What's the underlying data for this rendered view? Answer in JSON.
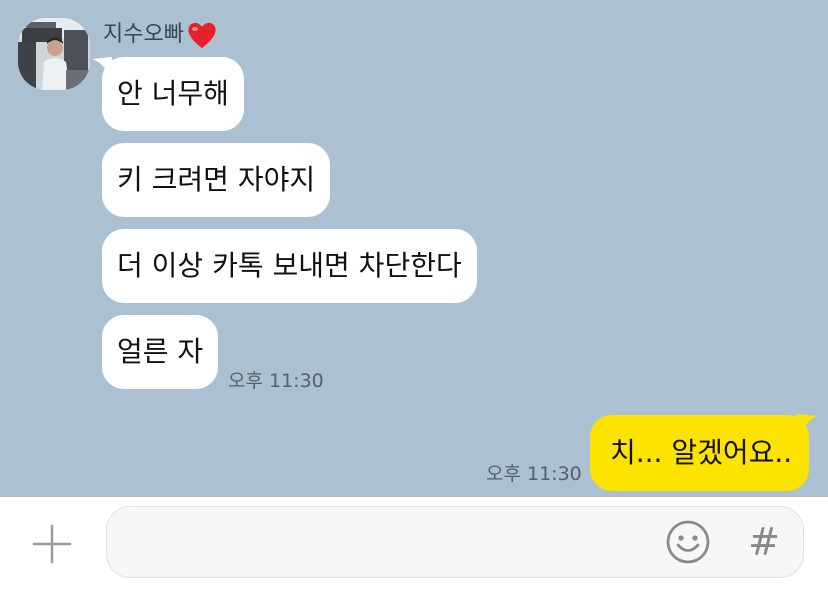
{
  "chat": {
    "sender_name": "지수오빠",
    "sender_badge_icon": "red-heart-icon",
    "incoming_messages": [
      {
        "text": "안 너무해"
      },
      {
        "text": "키 크려면 자야지"
      },
      {
        "text": "더 이상 카톡 보내면 차단한다"
      },
      {
        "text": "얼른 자"
      }
    ],
    "incoming_time": "오후 11:30",
    "outgoing_messages": [
      {
        "text": "치... 알겠어요.."
      }
    ],
    "outgoing_time": "오후 11:30"
  },
  "input_bar": {
    "plus_icon": "plus-icon",
    "input_value": "",
    "emoji_icon": "emoji-icon",
    "hash_label": "#"
  },
  "colors": {
    "chat_background": "#abc1d1",
    "incoming_bubble": "#ffffff",
    "outgoing_bubble": "#fce300",
    "heart": "#e8202a"
  }
}
